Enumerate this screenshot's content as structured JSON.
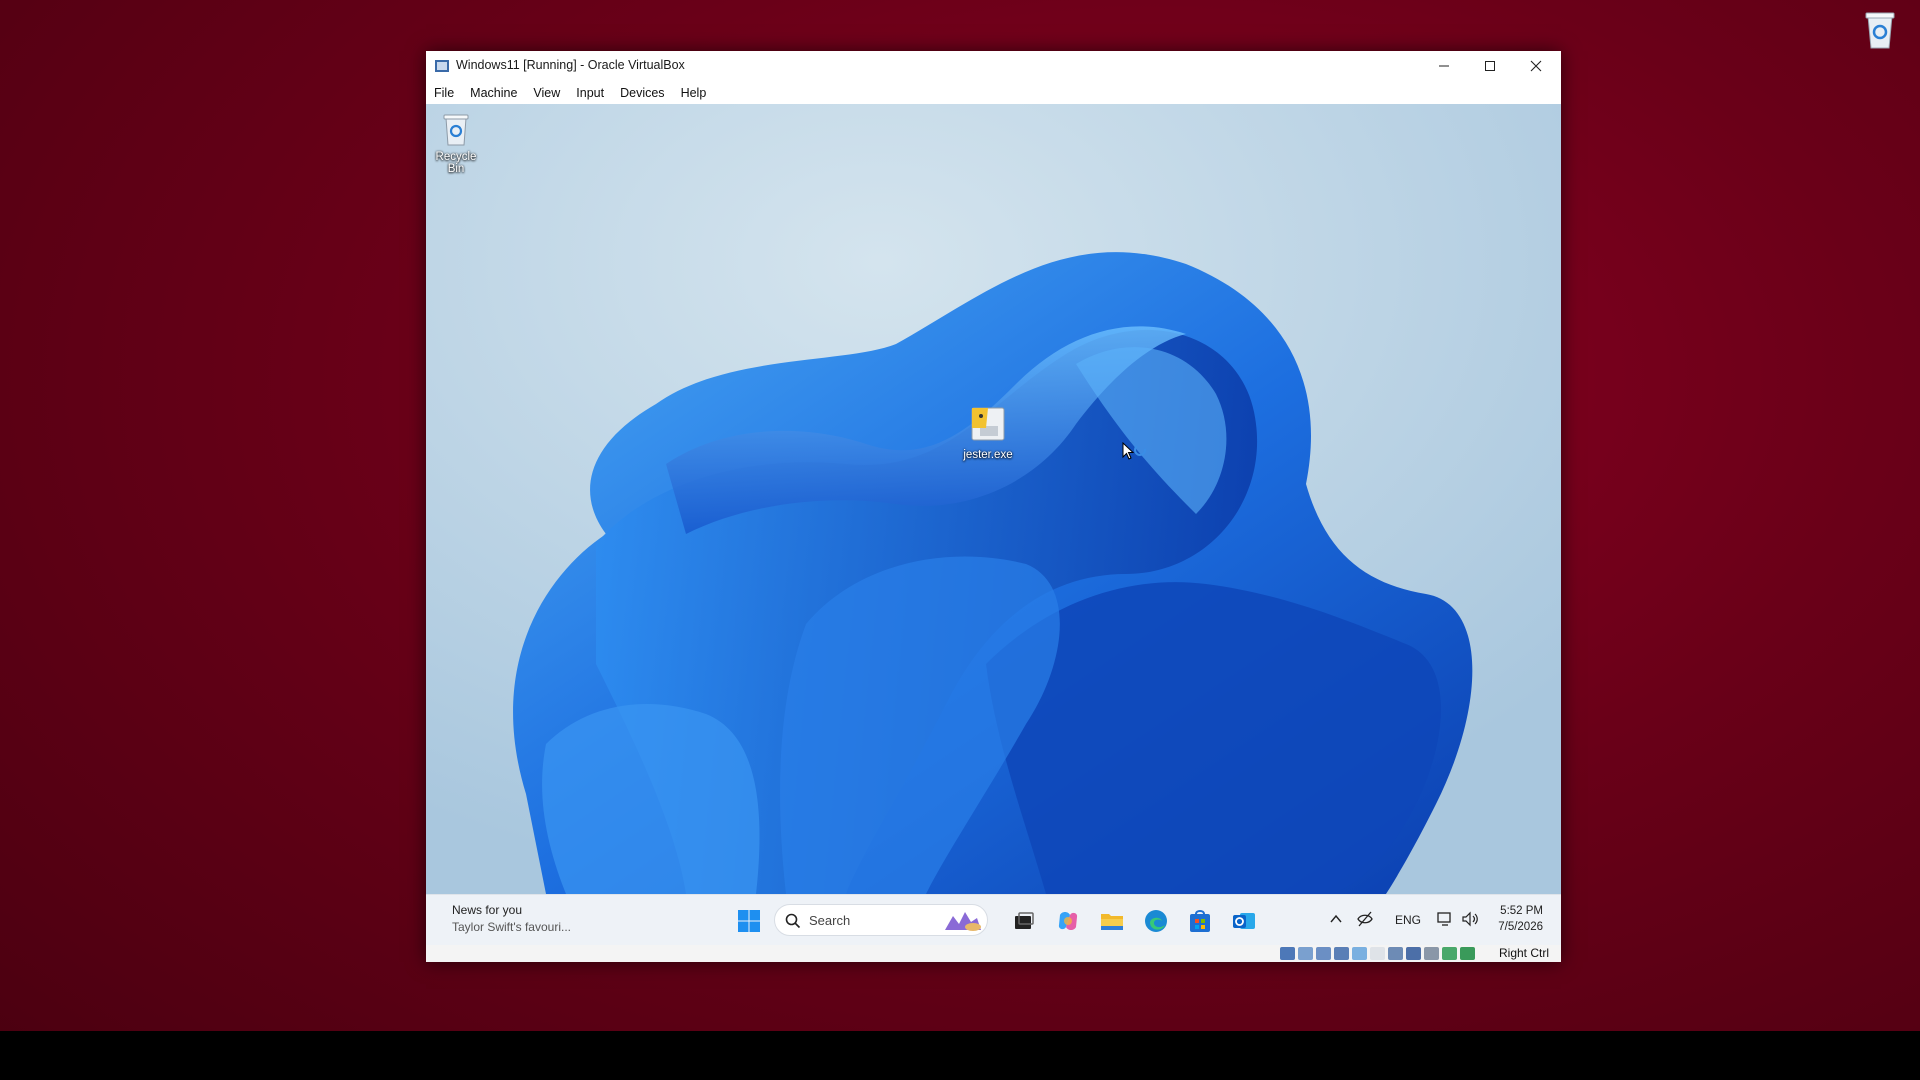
{
  "window": {
    "title": "Windows11 [Running] - Oracle VirtualBox",
    "menu": [
      "File",
      "Machine",
      "View",
      "Input",
      "Devices",
      "Help"
    ]
  },
  "desktop": {
    "icons": [
      {
        "label": "Recycle Bin",
        "icon": "recycle-bin-icon"
      },
      {
        "label": "jester.exe",
        "icon": "exe-file-icon"
      }
    ]
  },
  "taskbar": {
    "news_title": "News for you",
    "news_subtitle": "Taylor Swift's favouri...",
    "search_placeholder": "Search",
    "pinned_apps": [
      "widgets-icon",
      "task-view-icon",
      "copilot-icon",
      "file-explorer-icon",
      "edge-icon",
      "store-icon",
      "outlook-icon"
    ],
    "tray": {
      "language": "ENG",
      "time": "5:52 PM",
      "date": "7/5/2026"
    }
  },
  "statusbar": {
    "host_key": "Right Ctrl"
  },
  "colors": {
    "host_background": "#6a0018",
    "wallpaper_blue": "#1f6fe0",
    "taskbar": "#eef2f7"
  }
}
